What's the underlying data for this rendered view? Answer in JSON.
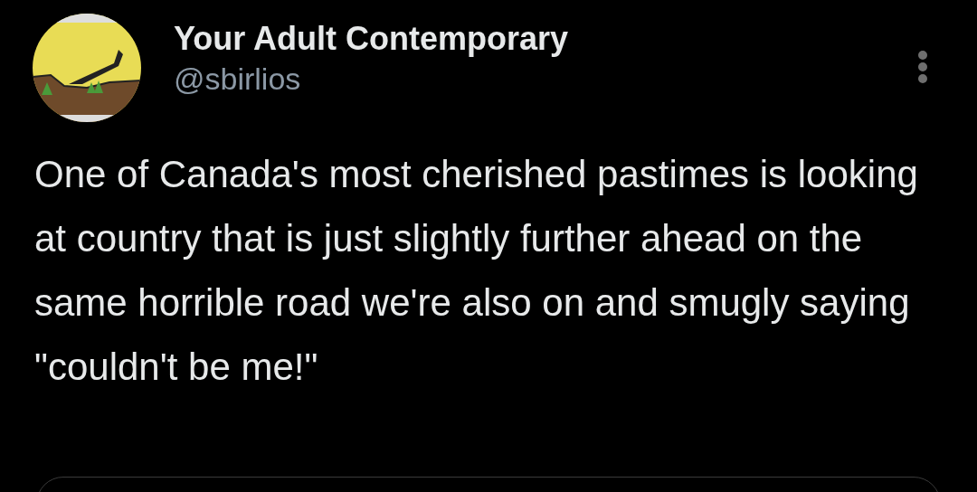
{
  "tweet": {
    "author": {
      "name": "Your Adult Contemporary",
      "handle": "@sbirlios"
    },
    "text": "One of Canada's most cherished pastimes is looking at country that is just slightly further ahead on the same horrible road we're also on and smugly saying \"couldn't be me!\"",
    "attachment": {
      "kind": "card"
    }
  }
}
